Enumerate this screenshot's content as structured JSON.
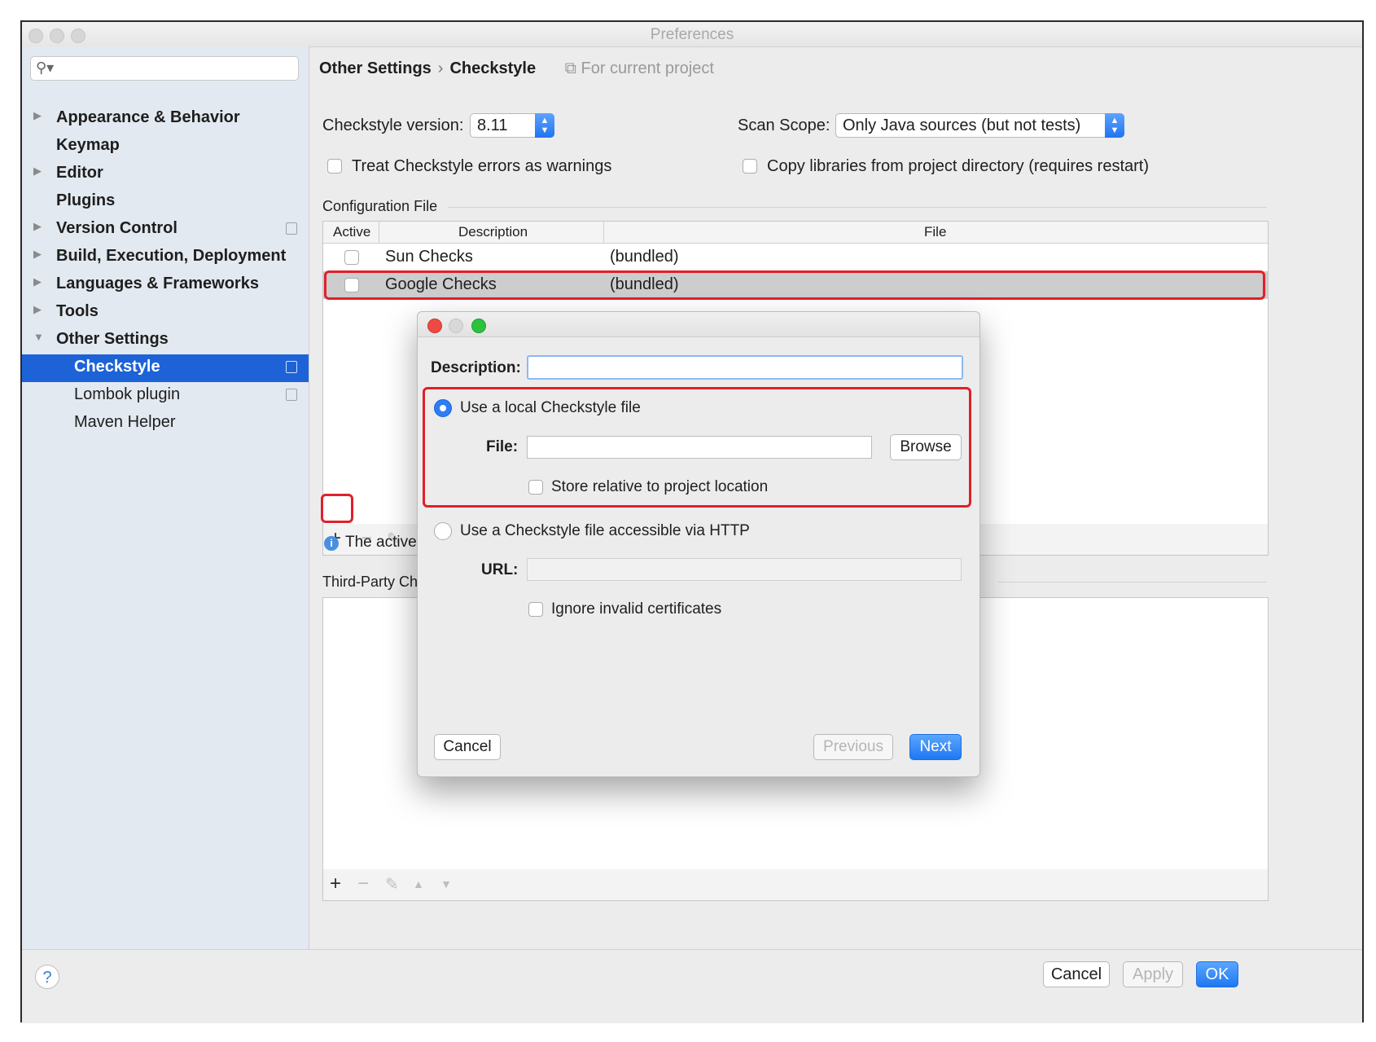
{
  "window": {
    "title": "Preferences"
  },
  "search": {
    "placeholder": ""
  },
  "sidebar": {
    "items": [
      {
        "label": "Appearance & Behavior"
      },
      {
        "label": "Keymap"
      },
      {
        "label": "Editor"
      },
      {
        "label": "Plugins"
      },
      {
        "label": "Version Control"
      },
      {
        "label": "Build, Execution, Deployment"
      },
      {
        "label": "Languages & Frameworks"
      },
      {
        "label": "Tools"
      },
      {
        "label": "Other Settings"
      },
      {
        "label": "Checkstyle"
      },
      {
        "label": "Lombok plugin"
      },
      {
        "label": "Maven Helper"
      }
    ]
  },
  "breadcrumb": {
    "parent": "Other Settings",
    "current": "Checkstyle",
    "scope_note": "For current project"
  },
  "settings": {
    "version_label": "Checkstyle version:",
    "version_value": "8.11",
    "scan_scope_label": "Scan Scope:",
    "scan_scope_value": "Only Java sources (but not tests)",
    "treat_errors_label": "Treat Checkstyle errors as warnings",
    "copy_libs_label": "Copy libraries from project directory (requires restart)"
  },
  "config": {
    "section_label": "Configuration File",
    "columns": [
      "Active",
      "Description",
      "File"
    ],
    "rows": [
      {
        "description": "Sun Checks",
        "file": "(bundled)"
      },
      {
        "description": "Google Checks",
        "file": "(bundled)"
      }
    ],
    "info_text": "The active rul"
  },
  "third_party": {
    "section_label": "Third-Party Check"
  },
  "toolbar": {
    "add": "+",
    "remove": "−",
    "edit": "✎",
    "up": "▲",
    "down": "▼"
  },
  "buttons": {
    "help": "?",
    "cancel": "Cancel",
    "apply": "Apply",
    "ok": "OK"
  },
  "dialog": {
    "description_label": "Description:",
    "description_value": "",
    "local_option": "Use a local Checkstyle file",
    "file_label": "File:",
    "file_value": "",
    "browse": "Browse",
    "store_relative": "Store relative to project location",
    "http_option": "Use a Checkstyle file accessible via HTTP",
    "url_label": "URL:",
    "url_value": "",
    "ignore_certs": "Ignore invalid certificates",
    "cancel": "Cancel",
    "previous": "Previous",
    "next": "Next"
  },
  "colors": {
    "selection": "#1d63d7",
    "highlight": "#e0202a",
    "primary_button": "#1f77f2"
  }
}
